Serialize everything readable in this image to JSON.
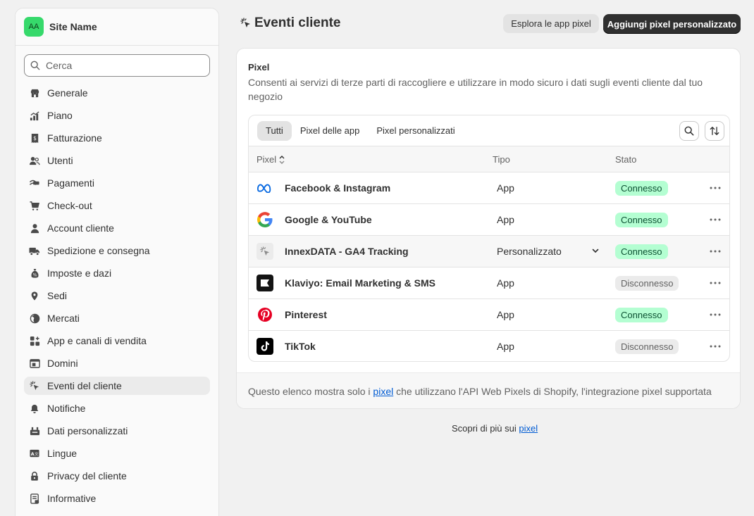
{
  "sidebar": {
    "avatar": "AA",
    "store_name": "Site Name",
    "search_placeholder": "Cerca",
    "items": [
      {
        "label": "Generale",
        "icon": "store-icon"
      },
      {
        "label": "Piano",
        "icon": "chart-icon"
      },
      {
        "label": "Fatturazione",
        "icon": "receipt-icon"
      },
      {
        "label": "Utenti",
        "icon": "users-icon"
      },
      {
        "label": "Pagamenti",
        "icon": "payment-icon"
      },
      {
        "label": "Check-out",
        "icon": "cart-icon"
      },
      {
        "label": "Account cliente",
        "icon": "person-icon"
      },
      {
        "label": "Spedizione e consegna",
        "icon": "truck-icon"
      },
      {
        "label": "Imposte e dazi",
        "icon": "tax-icon"
      },
      {
        "label": "Sedi",
        "icon": "location-icon"
      },
      {
        "label": "Mercati",
        "icon": "globe-icon"
      },
      {
        "label": "App e canali di vendita",
        "icon": "apps-icon"
      },
      {
        "label": "Domini",
        "icon": "domain-icon"
      },
      {
        "label": "Eventi del cliente",
        "icon": "cursor-click-icon",
        "active": true
      },
      {
        "label": "Notifiche",
        "icon": "bell-icon"
      },
      {
        "label": "Dati personalizzati",
        "icon": "database-icon"
      },
      {
        "label": "Lingue",
        "icon": "language-icon"
      },
      {
        "label": "Privacy del cliente",
        "icon": "lock-icon"
      },
      {
        "label": "Informative",
        "icon": "policy-icon"
      }
    ]
  },
  "header": {
    "title": "Eventi cliente",
    "secondary_button": "Esplora le app pixel",
    "primary_button": "Aggiungi pixel personalizzato"
  },
  "card": {
    "title": "Pixel",
    "description": "Consenti ai servizi di terze parti di raccogliere e utilizzare in modo sicuro i dati sugli eventi cliente dal tuo negozio",
    "tabs": [
      "Tutti",
      "Pixel delle app",
      "Pixel personalizzati"
    ],
    "columns": [
      "Pixel",
      "Tipo",
      "Stato"
    ],
    "rows": [
      {
        "name": "Facebook & Instagram",
        "type": "App",
        "status": "Connesso",
        "logo": "meta-icon"
      },
      {
        "name": "Google & YouTube",
        "type": "App",
        "status": "Connesso",
        "logo": "google-icon"
      },
      {
        "name": "InnexDATA - GA4 Tracking",
        "type": "Personalizzato",
        "status": "Connesso",
        "logo": "cursor-click-icon"
      },
      {
        "name": "Klaviyo: Email Marketing & SMS",
        "type": "App",
        "status": "Disconnesso",
        "logo": "klaviyo-icon"
      },
      {
        "name": "Pinterest",
        "type": "App",
        "status": "Connesso",
        "logo": "pinterest-icon"
      },
      {
        "name": "TikTok",
        "type": "App",
        "status": "Disconnesso",
        "logo": "tiktok-icon"
      }
    ],
    "footer_before": "Questo elenco mostra solo i ",
    "footer_link": "pixel",
    "footer_after": " che utilizzano l'API Web Pixels di Shopify, l'integrazione pixel supportata"
  },
  "learn_more": {
    "text": "Scopri di più sui ",
    "link": "pixel"
  },
  "colors": {
    "connected_bg": "#b4fed2",
    "connected_text": "#0c5132",
    "primary_button": "#303030",
    "link": "#005bd3"
  }
}
